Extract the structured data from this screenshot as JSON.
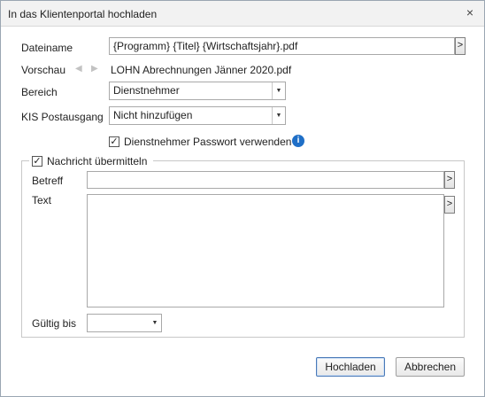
{
  "dialog": {
    "title": "In das Klientenportal hochladen",
    "close_label": "×"
  },
  "form": {
    "dateiname": {
      "label": "Dateiname",
      "value": "{Programm} {Titel} {Wirtschaftsjahr}.pdf",
      "button_label": ">"
    },
    "vorschau": {
      "label": "Vorschau",
      "value": "LOHN Abrechnungen Jänner 2020.pdf",
      "prev_label": "◀",
      "next_label": "▶"
    },
    "bereich": {
      "label": "Bereich",
      "value": "Dienstnehmer",
      "dropdown_label": "▼"
    },
    "kis_postausgang": {
      "label": "KIS Postausgang",
      "value": "Nicht hinzufügen",
      "dropdown_label": "▼"
    },
    "passwort": {
      "label": "Dienstnehmer Passwort verwenden",
      "checked": true,
      "check_mark": "✓",
      "info_label": "i"
    }
  },
  "nachricht": {
    "label": "Nachricht übermitteln",
    "checked": true,
    "check_mark": "✓",
    "betreff": {
      "label": "Betreff",
      "value": "",
      "button_label": ">"
    },
    "text": {
      "label": "Text",
      "value": "",
      "button_label": ">"
    },
    "gueltig_bis": {
      "label": "Gültig bis",
      "value": "",
      "dropdown_label": "▼"
    }
  },
  "footer": {
    "hochladen_label": "Hochladen",
    "abbrechen_label": "Abbrechen"
  }
}
